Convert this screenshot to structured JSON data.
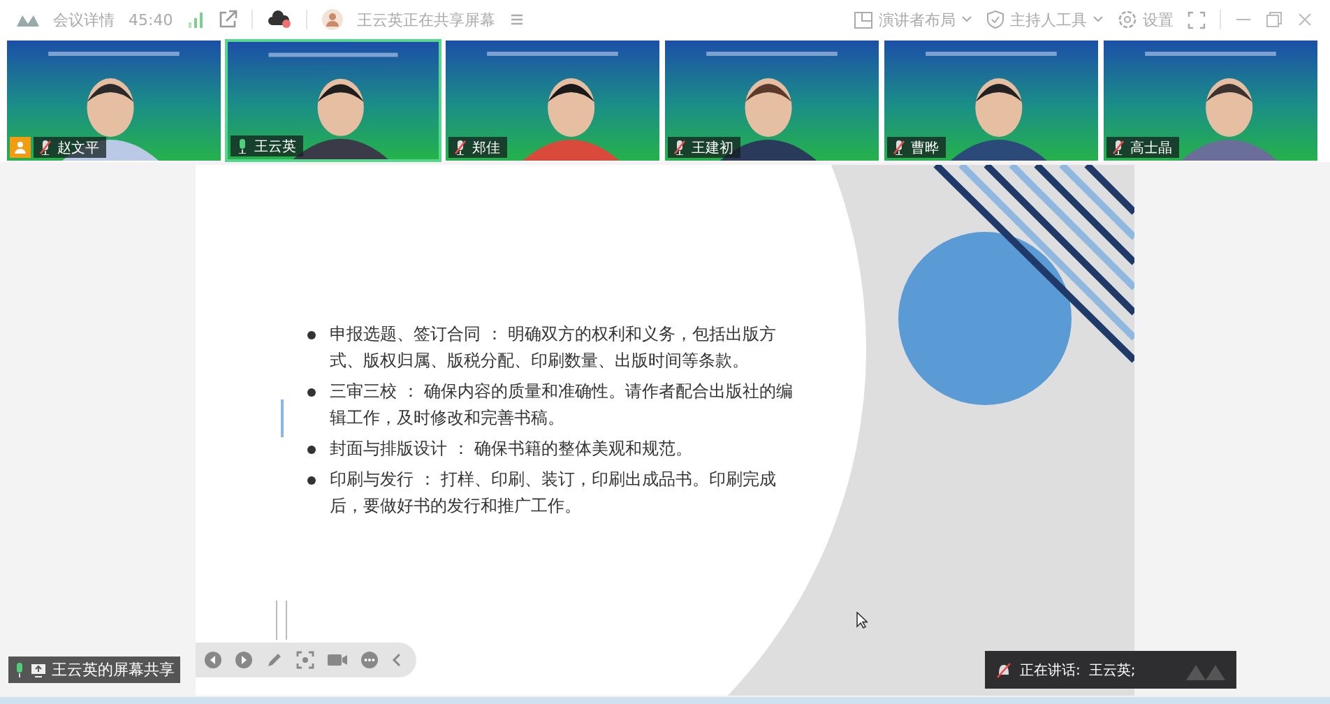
{
  "top_bar": {
    "meeting_details": "会议详情",
    "duration": "45:40",
    "sharing_notice": "王云英正在共享屏幕",
    "layout_button": "演讲者布局",
    "host_tools_button": "主持人工具",
    "settings_button": "设置"
  },
  "participants": [
    {
      "name": "赵文平",
      "muted": true,
      "host": true,
      "selected": false
    },
    {
      "name": "王云英",
      "muted": false,
      "host": false,
      "selected": true
    },
    {
      "name": "郑佳",
      "muted": true,
      "host": false,
      "selected": false
    },
    {
      "name": "王建初",
      "muted": true,
      "host": false,
      "selected": false
    },
    {
      "name": "曹晔",
      "muted": true,
      "host": false,
      "selected": false
    },
    {
      "name": "高士晶",
      "muted": true,
      "host": false,
      "selected": false
    }
  ],
  "slide": {
    "bullets": [
      "申报选题、签订合同 ： 明确双方的权利和义务，包括出版方式、版权归属、版税分配、印刷数量、出版时间等条款。",
      "三审三校 ： 确保内容的质量和准确性。请作者配合出版社的编辑工作，及时修改和完善书稿。",
      "封面与排版设计 ： 确保书籍的整体美观和规范。",
      "印刷与发行 ： 打样、印刷、装订，印刷出成品书。印刷完成后，要做好书的发行和推广工作。"
    ]
  },
  "share_label": "王云英的屏幕共享",
  "speaking": {
    "label": "正在讲话:",
    "names": "王云英;"
  }
}
